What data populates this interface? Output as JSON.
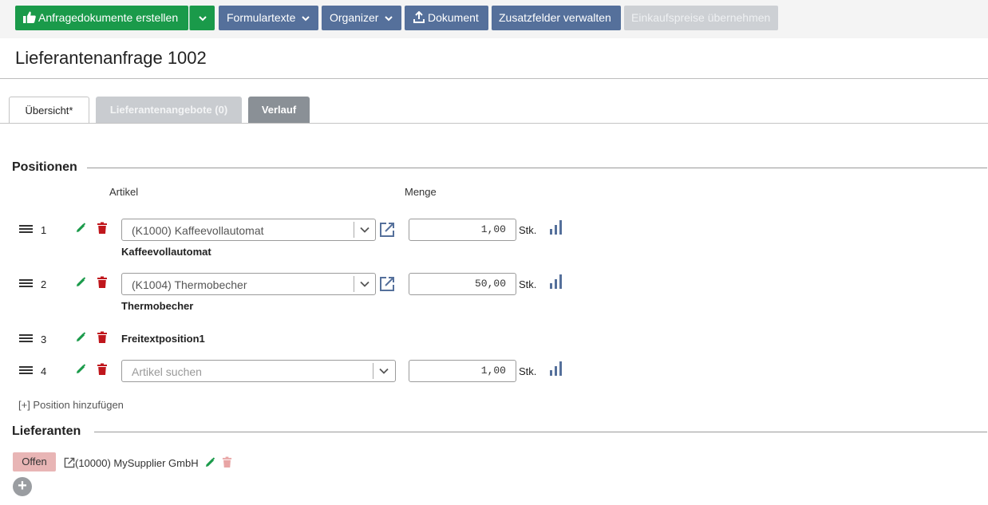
{
  "toolbar": {
    "create_docs_label": "Anfragedokumente erstellen",
    "form_texts_label": "Formulartexte",
    "organizer_label": "Organizer",
    "document_label": "Dokument",
    "extra_fields_label": "Zusatzfelder verwalten",
    "purchase_prices_label": "Einkaufspreise übernehmen"
  },
  "page": {
    "title": "Lieferantenanfrage 1002"
  },
  "tabs": [
    {
      "label": "Übersicht*"
    },
    {
      "label": "Lieferantenangebote (0)"
    },
    {
      "label": "Verlauf"
    }
  ],
  "positions": {
    "title": "Positionen",
    "col_article": "Artikel",
    "col_quantity": "Menge",
    "rows": [
      {
        "num": "1",
        "article": "(K1000) Kaffeevollautomat",
        "name": "Kaffeevollautomat",
        "qty": "1,00",
        "unit": "Stk."
      },
      {
        "num": "2",
        "article": "(K1004) Thermobecher",
        "name": "Thermobecher",
        "qty": "50,00",
        "unit": "Stk."
      },
      {
        "num": "3",
        "freetext": "Freitextposition1"
      },
      {
        "num": "4",
        "placeholder": "Artikel suchen",
        "qty": "1,00",
        "unit": "Stk."
      }
    ],
    "add_label": "[+] Position hinzufügen"
  },
  "suppliers": {
    "title": "Lieferanten",
    "status": "Offen",
    "name": "(10000) MySupplier GmbH",
    "add_symbol": "+"
  },
  "colors": {
    "green": "#1a9a4a",
    "blue": "#55709b",
    "disabled": "#cdd0d4",
    "red": "#c0161c",
    "status_badge": "#e8b5b5"
  },
  "icons": [
    "thumbs-up-icon",
    "chevron-down-icon",
    "upload-icon",
    "drag-handle-icon",
    "pencil-icon",
    "trash-icon",
    "external-link-icon",
    "bar-chart-icon",
    "plus-circle-icon"
  ]
}
